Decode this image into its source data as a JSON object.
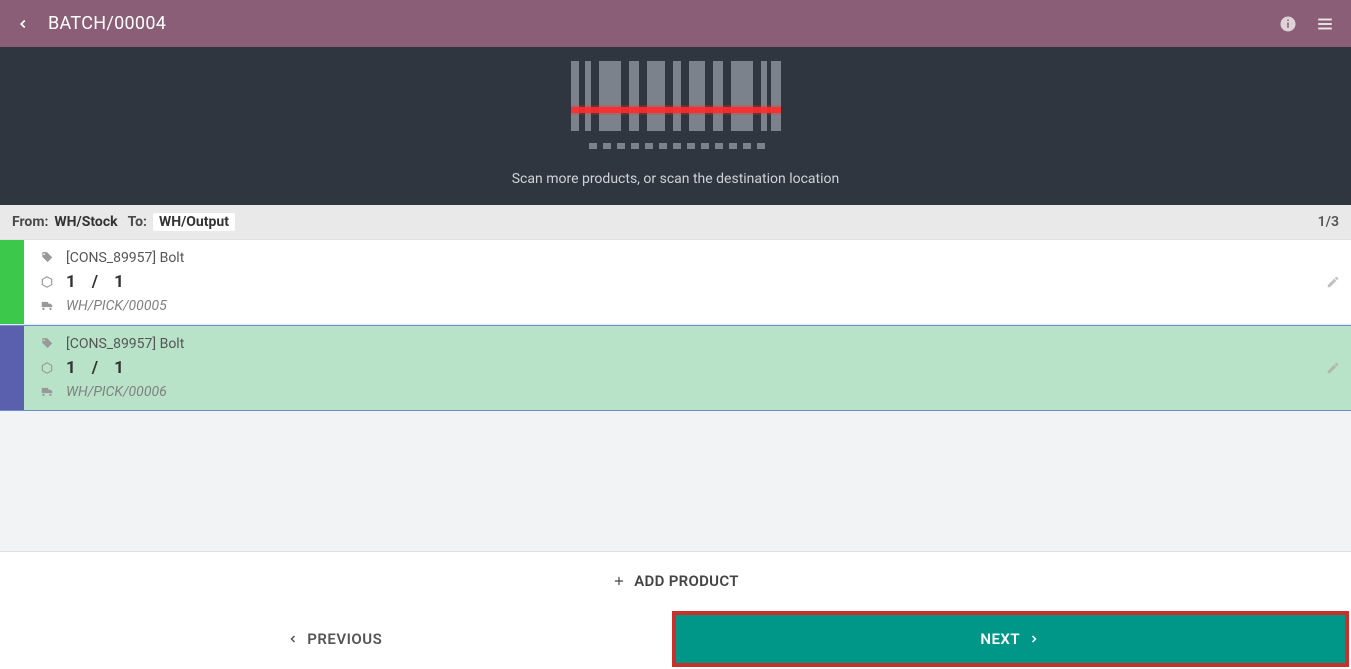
{
  "header": {
    "title": "BATCH/00004"
  },
  "scan": {
    "message": "Scan more products, or scan the destination location"
  },
  "locations": {
    "from_label": "From:",
    "from_value": "WH/Stock",
    "to_label": "To:",
    "to_value": "WH/Output",
    "pager": "1/3"
  },
  "lines": [
    {
      "status": "green",
      "product": "[CONS_89957] Bolt",
      "qty_done": "1",
      "qty_total": "1",
      "reference": "WH/PICK/00005"
    },
    {
      "status": "blue",
      "product": "[CONS_89957] Bolt",
      "qty_done": "1",
      "qty_total": "1",
      "reference": "WH/PICK/00006"
    }
  ],
  "actions": {
    "add_product": "ADD PRODUCT",
    "previous": "PREVIOUS",
    "next": "NEXT"
  }
}
